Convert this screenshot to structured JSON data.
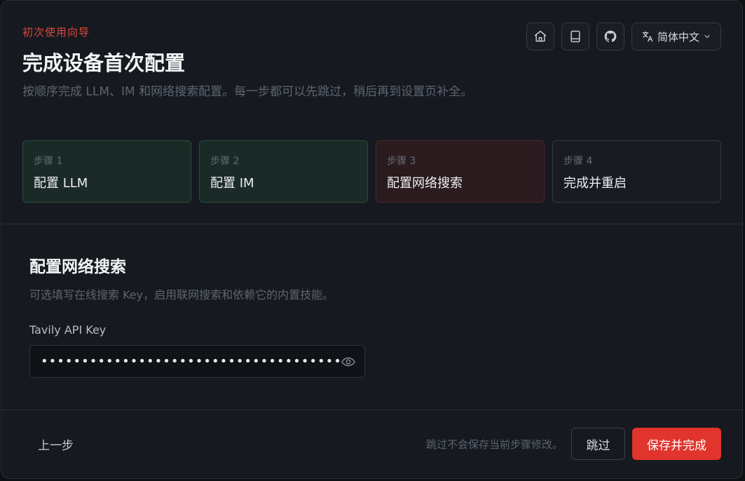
{
  "header": {
    "eyebrow": "初次使用向导",
    "title": "完成设备首次配置",
    "subtitle": "按顺序完成 LLM、IM 和网络搜索配置。每一步都可以先跳过，稍后再到设置页补全。",
    "language": "简体中文"
  },
  "icons": {
    "home": "home-icon",
    "docs": "book-icon",
    "github": "github-icon",
    "language": "translate-icon",
    "chevron": "chevron-down-icon",
    "visibility": "eye-icon"
  },
  "steps": [
    {
      "num": "步骤 1",
      "label": "配置 LLM",
      "state": "done"
    },
    {
      "num": "步骤 2",
      "label": "配置 IM",
      "state": "done"
    },
    {
      "num": "步骤 3",
      "label": "配置网络搜索",
      "state": "active"
    },
    {
      "num": "步骤 4",
      "label": "完成并重启",
      "state": "pending"
    }
  ],
  "section": {
    "title": "配置网络搜索",
    "description": "可选填写在线搜索 Key，启用联网搜索和依赖它的内置技能。",
    "field_label": "Tavily API Key",
    "field_value": "•••••••••••••••••••••••••••••••••••••••••••••••••"
  },
  "footer": {
    "prev_label": "上一步",
    "note": "跳过不会保存当前步骤修改。",
    "skip_label": "跳过",
    "save_label": "保存并完成"
  },
  "colors": {
    "accent": "#e0342d",
    "eyebrow": "#e0453a",
    "done_step_bg": "#1a2a27",
    "active_step_bg": "#2a1b1f"
  }
}
